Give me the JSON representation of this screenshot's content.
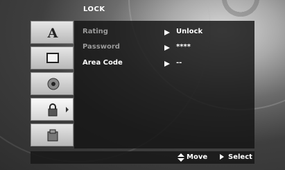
{
  "menu": {
    "title": "LOCK"
  },
  "sidebar": {
    "items": [
      {
        "icon": "language-a-icon"
      },
      {
        "icon": "display-icon"
      },
      {
        "icon": "audio-speaker-icon"
      },
      {
        "icon": "lock-icon"
      },
      {
        "icon": "others-icon"
      }
    ]
  },
  "settings": {
    "rows": [
      {
        "label": "Rating",
        "value": "Unlock"
      },
      {
        "label": "Password",
        "value": "****"
      },
      {
        "label": "Area Code",
        "value": "--"
      }
    ]
  },
  "footer": {
    "move_label": "Move",
    "select_label": "Select"
  }
}
